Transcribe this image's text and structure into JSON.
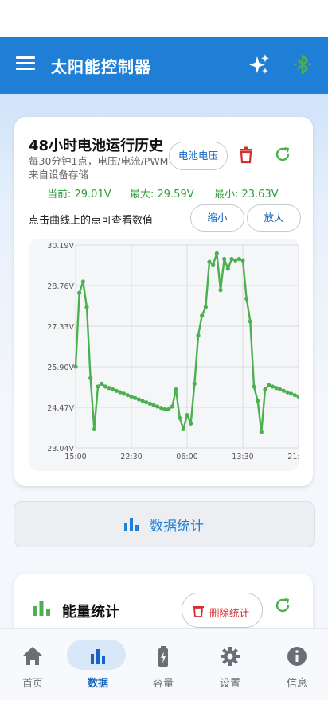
{
  "app": {
    "title": "太阳能控制器"
  },
  "history_card": {
    "title": "48小时电池运行历史",
    "subtitle": "每30分钟1点，电压/电流/PWM来自设备存储",
    "metric_button": "电池电压",
    "current": "当前: 29.01V",
    "max": "最大: 29.59V",
    "min": "最小: 23.63V",
    "hint": "点击曲线上的点可查看数值",
    "zoom_out": "缩小",
    "zoom_in": "放大"
  },
  "stats_button": {
    "label": "数据统计"
  },
  "energy_card": {
    "title": "能量统计",
    "delete_label": "删除统计"
  },
  "nav": {
    "items": [
      {
        "label": "首页",
        "icon": "home-icon"
      },
      {
        "label": "数据",
        "icon": "bar-chart-icon"
      },
      {
        "label": "容量",
        "icon": "battery-icon"
      },
      {
        "label": "设置",
        "icon": "gear-icon"
      },
      {
        "label": "信息",
        "icon": "info-icon"
      }
    ],
    "active": "数据"
  },
  "colors": {
    "primary": "#1f7fd6",
    "series": "#4caf50",
    "danger": "#d32f2f",
    "bluetooth": "#4caf50"
  },
  "chart_data": {
    "type": "line",
    "y_tick_labels": [
      "30.19V",
      "28.76V",
      "27.33V",
      "25.90V",
      "24.47V",
      "23.04V"
    ],
    "y_ticks": [
      30.19,
      28.76,
      27.33,
      25.9,
      24.47,
      23.04
    ],
    "ylim": [
      23.04,
      30.19
    ],
    "x_tick_labels": [
      "15:00",
      "22:30",
      "06:00",
      "13:30",
      "21:00"
    ],
    "x_tick_index": [
      0,
      15,
      30,
      45,
      60
    ],
    "grid": true,
    "series": [
      {
        "values": [
          25.9,
          28.5,
          28.9,
          28.0,
          25.5,
          23.7,
          25.2,
          25.3,
          25.2,
          25.15,
          25.1,
          25.05,
          25.0,
          24.95,
          24.9,
          24.85,
          24.8,
          24.75,
          24.7,
          24.65,
          24.6,
          24.55,
          24.5,
          24.45,
          24.4,
          24.4,
          24.5,
          25.1,
          24.1,
          23.7,
          24.2,
          23.9,
          25.3,
          27.0,
          27.7,
          28.0,
          29.6,
          29.5,
          29.9,
          28.6,
          29.7,
          29.35,
          29.7,
          29.65,
          29.7,
          29.65,
          28.3,
          27.5,
          25.2,
          24.7,
          23.6,
          25.1,
          25.25,
          25.2,
          25.15,
          25.1,
          25.05,
          25.0,
          24.95,
          24.9,
          24.85
        ]
      }
    ]
  }
}
